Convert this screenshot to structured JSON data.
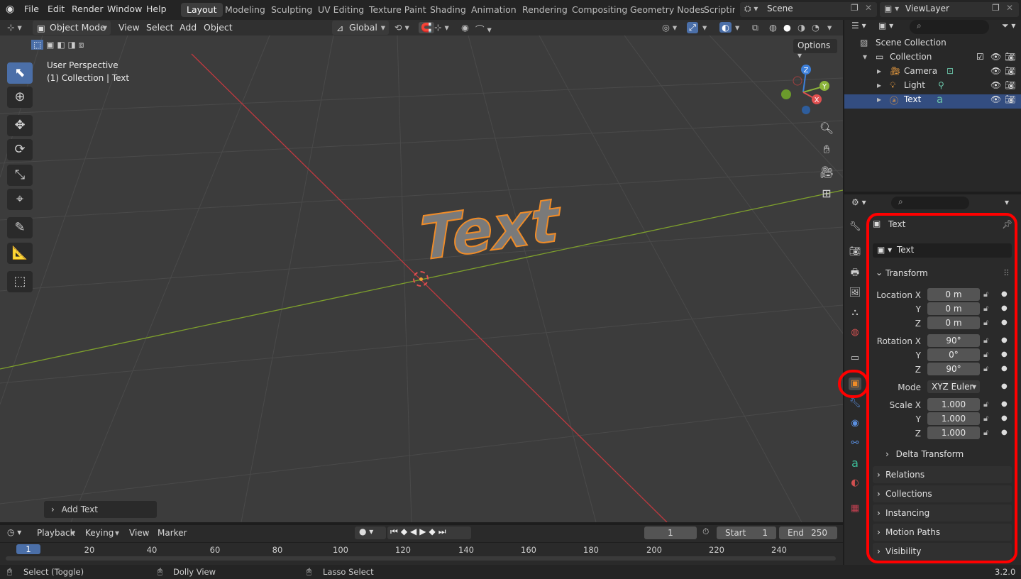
{
  "menu": {
    "items": [
      "File",
      "Edit",
      "Render",
      "Window",
      "Help"
    ]
  },
  "workspaces": [
    "Layout",
    "Modeling",
    "Sculpting",
    "UV Editing",
    "Texture Paint",
    "Shading",
    "Animation",
    "Rendering",
    "Compositing",
    "Geometry Nodes",
    "Scripting"
  ],
  "scene": {
    "name": "Scene",
    "view_layer": "ViewLayer"
  },
  "viewport_header": {
    "mode": "Object Mode",
    "menus": [
      "View",
      "Select",
      "Add",
      "Object"
    ],
    "orientation": "Global",
    "options": "Options"
  },
  "viewport": {
    "perspective": "User Perspective",
    "context": "(1) Collection | Text",
    "object_text": "Text",
    "last_op": "Add Text",
    "gizmo_labels": {
      "x": "X",
      "y": "Y",
      "z": "Z"
    }
  },
  "outliner": {
    "root": "Scene Collection",
    "collection": "Collection",
    "items": [
      {
        "name": "Camera"
      },
      {
        "name": "Light"
      },
      {
        "name": "Text",
        "selected": true
      }
    ]
  },
  "properties": {
    "object_name": "Text",
    "data_name": "Text",
    "transform_title": "Transform",
    "location": {
      "label_x": "Location X",
      "label_y": "Y",
      "label_z": "Z",
      "x": "0 m",
      "y": "0 m",
      "z": "0 m"
    },
    "rotation": {
      "label_x": "Rotation X",
      "label_y": "Y",
      "label_z": "Z",
      "x": "90°",
      "y": "0°",
      "z": "90°"
    },
    "mode": {
      "label": "Mode",
      "value": "XYZ Euler"
    },
    "scale": {
      "label_x": "Scale X",
      "label_y": "Y",
      "label_z": "Z",
      "x": "1.000",
      "y": "1.000",
      "z": "1.000"
    },
    "delta": "Delta Transform",
    "panels": [
      "Relations",
      "Collections",
      "Instancing",
      "Motion Paths",
      "Visibility"
    ]
  },
  "timeline": {
    "menus": [
      "Playback",
      "Keying",
      "View",
      "Marker"
    ],
    "current_frame": "1",
    "start_label": "Start",
    "start": "1",
    "end_label": "End",
    "end": "250",
    "ticks": [
      "1",
      "20",
      "40",
      "60",
      "80",
      "100",
      "120",
      "140",
      "160",
      "180",
      "200",
      "220",
      "240"
    ]
  },
  "status": {
    "select": "Select (Toggle)",
    "dolly": "Dolly View",
    "lasso": "Lasso Select",
    "version": "3.2.0"
  },
  "colors": {
    "accent": "#4b6fa8",
    "highlight": "#ff0000",
    "selected_outline": "#f08c28",
    "x_axis": "#e05050",
    "y_axis": "#8bb33a",
    "z_axis": "#3d7fd9"
  }
}
